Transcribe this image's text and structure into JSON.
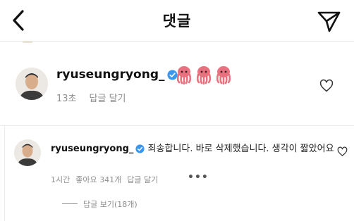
{
  "header": {
    "title": "댓글",
    "back_icon": "chevron-left-icon",
    "send_icon": "paper-plane-icon"
  },
  "comment_main": {
    "username": "ryuseungryong_",
    "verified_icon": "verified-badge-icon",
    "emoji": [
      "octopus",
      "octopus",
      "octopus"
    ],
    "time": "13초",
    "reply_label": "답글 달기",
    "like_icon": "heart-outline-icon"
  },
  "comment_reply": {
    "username": "ryuseungryong_",
    "verified_icon": "verified-badge-icon",
    "text": "죄송합니다. 바로 삭제했습니다. 생각이 짧았어요",
    "time": "1시간",
    "likes_label": "좋아요 341개",
    "reply_label": "답글 달기",
    "more_label": "•••",
    "like_icon": "heart-outline-icon"
  },
  "view_replies": {
    "label": "답글 보기(18개)"
  },
  "colors": {
    "verified": "#3897f0",
    "octopus": "#e8717f",
    "secondary_text": "#8e8e8e"
  }
}
